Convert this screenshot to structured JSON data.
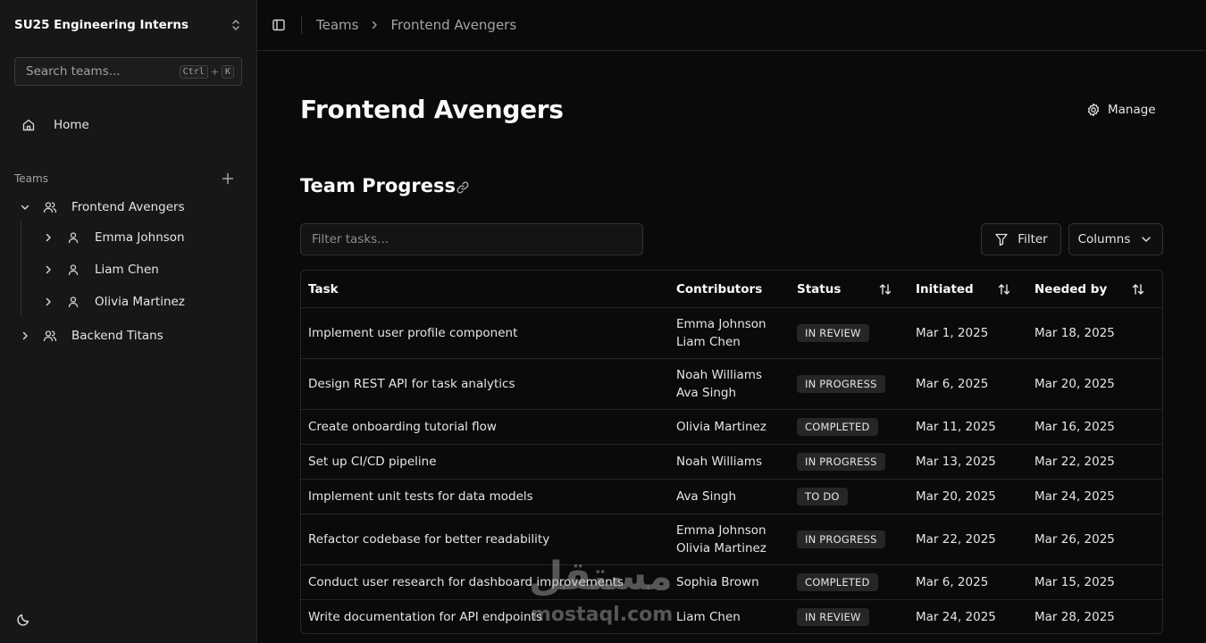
{
  "sidebar": {
    "workspace": "SU25 Engineering Interns",
    "search": {
      "placeholder": "Search teams...",
      "shortcut_key1": "Ctrl",
      "shortcut_plus": "+",
      "shortcut_key2": "K"
    },
    "home": "Home",
    "teams_label": "Teams",
    "tree": [
      {
        "label": "Frontend Avengers",
        "expanded": true,
        "icon": "users-icon",
        "members": [
          "Emma Johnson",
          "Liam Chen",
          "Olivia Martinez"
        ]
      },
      {
        "label": "Backend Titans",
        "expanded": false,
        "icon": "users-icon"
      }
    ]
  },
  "topbar": {
    "breadcrumb": [
      "Teams",
      "Frontend Avengers"
    ]
  },
  "main": {
    "title": "Frontend Avengers",
    "manage_label": "Manage",
    "section_title": "Team Progress",
    "filter_placeholder": "Filter tasks...",
    "filter_button": "Filter",
    "columns_button": "Columns"
  },
  "table": {
    "headers": [
      "Task",
      "Contributors",
      "Status",
      "Initiated",
      "Needed by"
    ],
    "rows": [
      {
        "task": "Implement user profile component",
        "contributors": [
          "Emma Johnson",
          "Liam Chen"
        ],
        "status": "IN REVIEW",
        "initiated": "Mar 1, 2025",
        "needed_by": "Mar 18, 2025"
      },
      {
        "task": "Design REST API for task analytics",
        "contributors": [
          "Noah Williams",
          "Ava Singh"
        ],
        "status": "IN PROGRESS",
        "initiated": "Mar 6, 2025",
        "needed_by": "Mar 20, 2025"
      },
      {
        "task": "Create onboarding tutorial flow",
        "contributors": [
          "Olivia Martinez"
        ],
        "status": "COMPLETED",
        "initiated": "Mar 11, 2025",
        "needed_by": "Mar 16, 2025"
      },
      {
        "task": "Set up CI/CD pipeline",
        "contributors": [
          "Noah Williams"
        ],
        "status": "IN PROGRESS",
        "initiated": "Mar 13, 2025",
        "needed_by": "Mar 22, 2025"
      },
      {
        "task": "Implement unit tests for data models",
        "contributors": [
          "Ava Singh"
        ],
        "status": "TO DO",
        "initiated": "Mar 20, 2025",
        "needed_by": "Mar 24, 2025"
      },
      {
        "task": "Refactor codebase for better readability",
        "contributors": [
          "Emma Johnson",
          "Olivia Martinez"
        ],
        "status": "IN PROGRESS",
        "initiated": "Mar 22, 2025",
        "needed_by": "Mar 26, 2025"
      },
      {
        "task": "Conduct user research for dashboard improvements",
        "contributors": [
          "Sophia Brown"
        ],
        "status": "COMPLETED",
        "initiated": "Mar 6, 2025",
        "needed_by": "Mar 15, 2025"
      },
      {
        "task": "Write documentation for API endpoints",
        "contributors": [
          "Liam Chen"
        ],
        "status": "IN REVIEW",
        "initiated": "Mar 24, 2025",
        "needed_by": "Mar 28, 2025"
      }
    ]
  },
  "watermark": {
    "arabic": "مستقل",
    "latin": "mostaql.com"
  }
}
